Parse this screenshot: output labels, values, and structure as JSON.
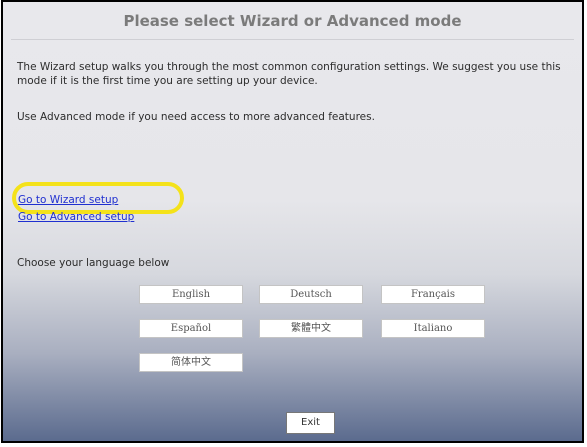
{
  "dialog": {
    "title": "Please select Wizard or Advanced mode",
    "description": "The Wizard setup walks you through the most common configuration settings. We suggest you use this mode if it is the first time you are setting up your device.",
    "advanced_note": "Use Advanced mode if you need access to more advanced features.",
    "wizard_link": "Go to Wizard setup",
    "advanced_link": "Go to Advanced setup",
    "language_heading": "Choose your language below",
    "languages": [
      "English",
      "Deutsch",
      "Français",
      "Español",
      "繁體中文",
      "Italiano",
      "简体中文"
    ],
    "exit_label": "Exit"
  },
  "colors": {
    "link": "#1f2fd0",
    "highlight": "#f4e21a",
    "title": "#7b7b7b"
  }
}
